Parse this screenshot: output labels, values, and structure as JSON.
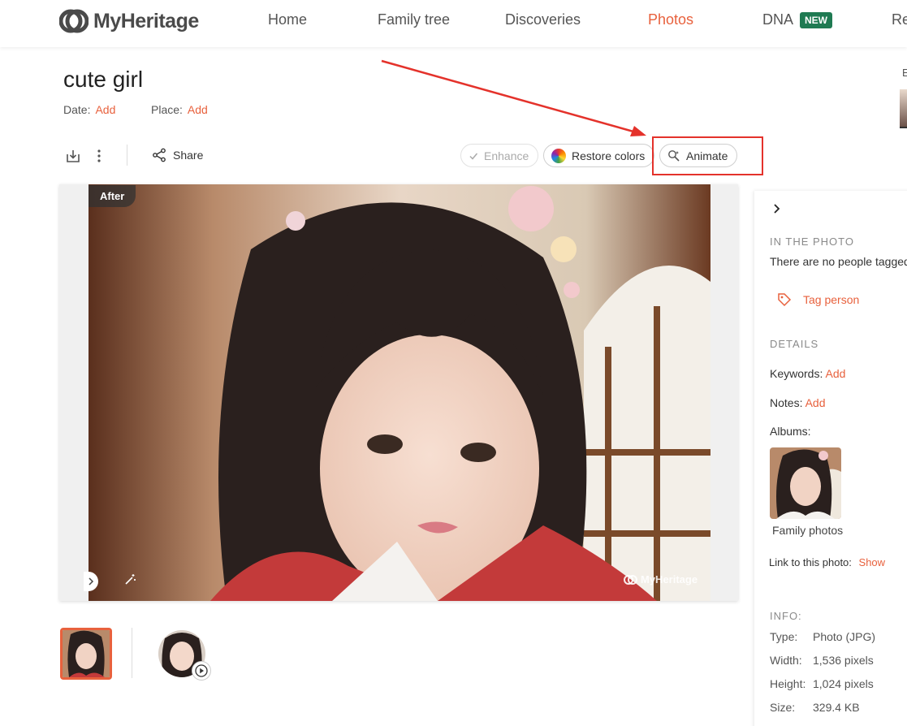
{
  "header": {
    "logo_text": "MyHeritage",
    "nav": [
      {
        "label": "Home"
      },
      {
        "label": "Family tree"
      },
      {
        "label": "Discoveries"
      },
      {
        "label": "Photos",
        "active": true
      },
      {
        "label": "DNA"
      },
      {
        "label": "Re"
      }
    ],
    "new_badge": "NEW",
    "corner_letter": "E"
  },
  "photo": {
    "title": "cute girl",
    "date_label": "Date:",
    "date_link": "Add",
    "place_label": "Place:",
    "place_link": "Add",
    "after_label": "After",
    "watermark": "MyHeritage"
  },
  "toolbar": {
    "share_label": "Share",
    "enhance_label": "Enhance",
    "restore_label": "Restore colors",
    "animate_label": "Animate"
  },
  "panel": {
    "in_photo_heading": "IN THE PHOTO",
    "no_people_text": "There are no people tagged",
    "tag_person": "Tag person",
    "details_heading": "DETAILS",
    "keywords_label": "Keywords:",
    "keywords_link": "Add",
    "notes_label": "Notes:",
    "notes_link": "Add",
    "albums_label": "Albums:",
    "album_name": "Family photos",
    "link_label": "Link to this photo:",
    "link_action": "Show",
    "info_heading": "INFO:",
    "info": [
      {
        "key": "Type:",
        "value": "Photo (JPG)"
      },
      {
        "key": "Width:",
        "value": "1,536 pixels"
      },
      {
        "key": "Height:",
        "value": "1,024 pixels"
      },
      {
        "key": "Size:",
        "value": "329.4 KB"
      }
    ]
  },
  "colors": {
    "accent": "#e8613d",
    "new_badge": "#1f7a52",
    "annotation": "#e4322b"
  },
  "icons": [
    "logo-icon",
    "download-icon",
    "more-icon",
    "share-icon",
    "check-icon",
    "color-wheel-icon",
    "animate-icon",
    "chevron-right-icon",
    "tag-icon",
    "play-icon",
    "wand-icon"
  ]
}
